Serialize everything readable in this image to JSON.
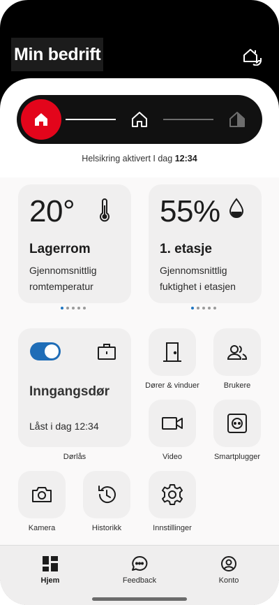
{
  "header": {
    "title": "Min bedrift",
    "switch_icon": "home-switch-icon"
  },
  "stepper": {
    "steps": [
      "home-icon",
      "home-outline-icon",
      "home-half-icon"
    ],
    "active_index": 0
  },
  "status": {
    "prefix": "Helsikring aktivert I dag",
    "time": "12:34"
  },
  "cards": [
    {
      "value": "20°",
      "title": "Lagerrom",
      "description": "Gjennomsnittlig romtemperatur",
      "icon": "thermometer-icon",
      "page_index": 0,
      "page_count": 5
    },
    {
      "value": "55%",
      "title": "1. etasje",
      "description": "Gjennomsnittlig fuktighet i etasjen",
      "icon": "water-drop-icon",
      "page_index": 0,
      "page_count": 5
    }
  ],
  "door_lock": {
    "title": "Inngangsdør",
    "status": "Låst i dag 12:34",
    "label": "Dørlås",
    "toggle_on": true,
    "icon": "briefcase-icon"
  },
  "tiles": [
    {
      "label": "Dører & vinduer",
      "icon": "door-icon"
    },
    {
      "label": "Brukere",
      "icon": "users-icon"
    },
    {
      "label": "Video",
      "icon": "video-camera-icon"
    },
    {
      "label": "Smartplugger",
      "icon": "smart-plug-icon"
    },
    {
      "label": "Kamera",
      "icon": "camera-icon"
    },
    {
      "label": "Historikk",
      "icon": "history-icon"
    },
    {
      "label": "Innstillinger",
      "icon": "gear-icon"
    }
  ],
  "tabbar": {
    "items": [
      {
        "label": "Hjem",
        "icon": "dashboard-icon",
        "active": true
      },
      {
        "label": "Feedback",
        "icon": "chat-bubble-icon",
        "active": false
      },
      {
        "label": "Konto",
        "icon": "account-icon",
        "active": false
      }
    ]
  },
  "colors": {
    "accent": "#e3051b",
    "toggle": "#1f6db7",
    "dot_active": "#1f76c2",
    "card_bg": "#f0efef"
  }
}
